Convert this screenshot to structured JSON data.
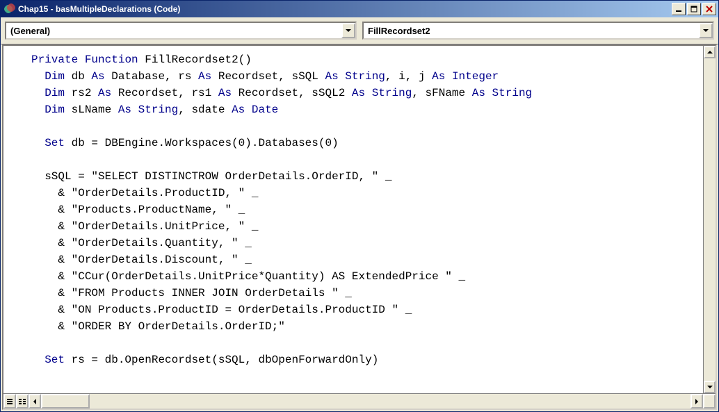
{
  "window": {
    "title": "Chap15 - basMultipleDeclarations (Code)"
  },
  "dropdowns": {
    "scope": "(General)",
    "proc": "FillRecordset2"
  },
  "code": {
    "lines": [
      [
        {
          "t": "Private",
          "c": "kw"
        },
        {
          "t": " "
        },
        {
          "t": "Function",
          "c": "kw"
        },
        {
          "t": " FillRecordset2()"
        }
      ],
      [
        {
          "t": "  "
        },
        {
          "t": "Dim",
          "c": "kw"
        },
        {
          "t": " db "
        },
        {
          "t": "As",
          "c": "kw"
        },
        {
          "t": " Database, rs "
        },
        {
          "t": "As",
          "c": "kw"
        },
        {
          "t": " Recordset, sSQL "
        },
        {
          "t": "As",
          "c": "kw"
        },
        {
          "t": " "
        },
        {
          "t": "String",
          "c": "kw"
        },
        {
          "t": ", i, j "
        },
        {
          "t": "As",
          "c": "kw"
        },
        {
          "t": " "
        },
        {
          "t": "Integer",
          "c": "kw"
        }
      ],
      [
        {
          "t": "  "
        },
        {
          "t": "Dim",
          "c": "kw"
        },
        {
          "t": " rs2 "
        },
        {
          "t": "As",
          "c": "kw"
        },
        {
          "t": " Recordset, rs1 "
        },
        {
          "t": "As",
          "c": "kw"
        },
        {
          "t": " Recordset, sSQL2 "
        },
        {
          "t": "As",
          "c": "kw"
        },
        {
          "t": " "
        },
        {
          "t": "String",
          "c": "kw"
        },
        {
          "t": ", sFName "
        },
        {
          "t": "As",
          "c": "kw"
        },
        {
          "t": " "
        },
        {
          "t": "String",
          "c": "kw"
        }
      ],
      [
        {
          "t": "  "
        },
        {
          "t": "Dim",
          "c": "kw"
        },
        {
          "t": " sLName "
        },
        {
          "t": "As",
          "c": "kw"
        },
        {
          "t": " "
        },
        {
          "t": "String",
          "c": "kw"
        },
        {
          "t": ", sdate "
        },
        {
          "t": "As",
          "c": "kw"
        },
        {
          "t": " "
        },
        {
          "t": "Date",
          "c": "kw"
        }
      ],
      [
        {
          "t": ""
        }
      ],
      [
        {
          "t": "  "
        },
        {
          "t": "Set",
          "c": "kw"
        },
        {
          "t": " db = DBEngine.Workspaces(0).Databases(0)"
        }
      ],
      [
        {
          "t": ""
        }
      ],
      [
        {
          "t": "  sSQL = \"SELECT DISTINCTROW OrderDetails.OrderID, \" _"
        }
      ],
      [
        {
          "t": "    & \"OrderDetails.ProductID, \" _"
        }
      ],
      [
        {
          "t": "    & \"Products.ProductName, \" _"
        }
      ],
      [
        {
          "t": "    & \"OrderDetails.UnitPrice, \" _"
        }
      ],
      [
        {
          "t": "    & \"OrderDetails.Quantity, \" _"
        }
      ],
      [
        {
          "t": "    & \"OrderDetails.Discount, \" _"
        }
      ],
      [
        {
          "t": "    & \"CCur(OrderDetails.UnitPrice*Quantity) AS ExtendedPrice \" _"
        }
      ],
      [
        {
          "t": "    & \"FROM Products INNER JOIN OrderDetails \" _"
        }
      ],
      [
        {
          "t": "    & \"ON Products.ProductID = OrderDetails.ProductID \" _"
        }
      ],
      [
        {
          "t": "    & \"ORDER BY OrderDetails.OrderID;\""
        }
      ],
      [
        {
          "t": ""
        }
      ],
      [
        {
          "t": "  "
        },
        {
          "t": "Set",
          "c": "kw"
        },
        {
          "t": " rs = db.OpenRecordset(sSQL, dbOpenForwardOnly)"
        }
      ]
    ]
  }
}
